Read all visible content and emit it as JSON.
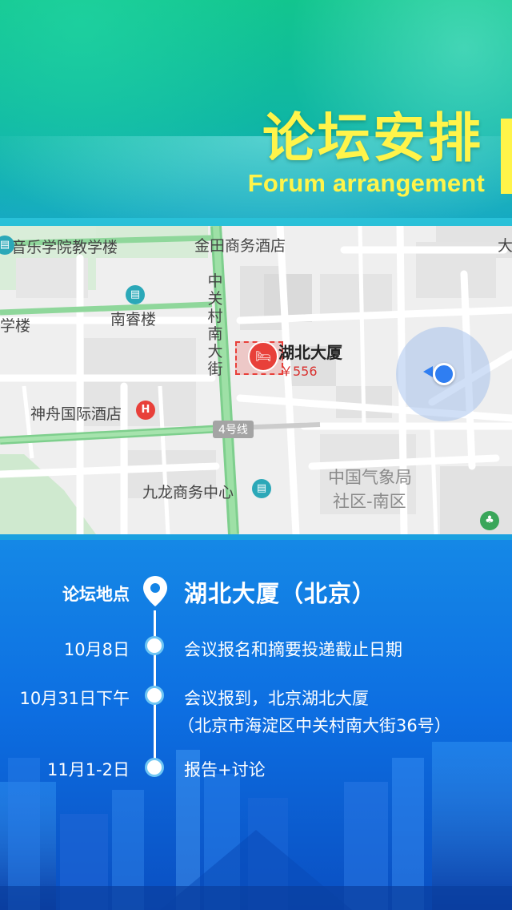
{
  "header": {
    "title_cn": "论坛安排",
    "title_en": "Forum arrangement",
    "accent_color": "#fff44a"
  },
  "map": {
    "labels": {
      "music_building": "音乐学院教学楼",
      "jintian_hotel": "金田商务酒店",
      "da": "大",
      "xuelou": "学楼",
      "nanrui": "南睿楼",
      "street_vertical": "中关村南大街",
      "hotel_name": "湖北大厦",
      "hotel_price": "￥556",
      "shenzhou_hotel": "神舟国际酒店",
      "line4": "4号线",
      "weather_bureau_1": "中国气象局",
      "weather_bureau_2": "社区-南区",
      "jiulong": "九龙商务中心"
    },
    "icons": [
      "building-icon",
      "hotel-icon",
      "location-pin-icon",
      "current-location-icon"
    ]
  },
  "schedule": {
    "venue_label": "论坛地点",
    "venue_value": "湖北大厦（北京）",
    "items": [
      {
        "date": "10月8日",
        "text": "会议报名和摘要投递截止日期"
      },
      {
        "date": "10月31日下午",
        "text": "会议报到，北京湖北大厦",
        "text2": "（北京市海淀区中关村南大街36号）"
      },
      {
        "date": "11月1-2日",
        "text": "报告+讨论"
      }
    ]
  }
}
